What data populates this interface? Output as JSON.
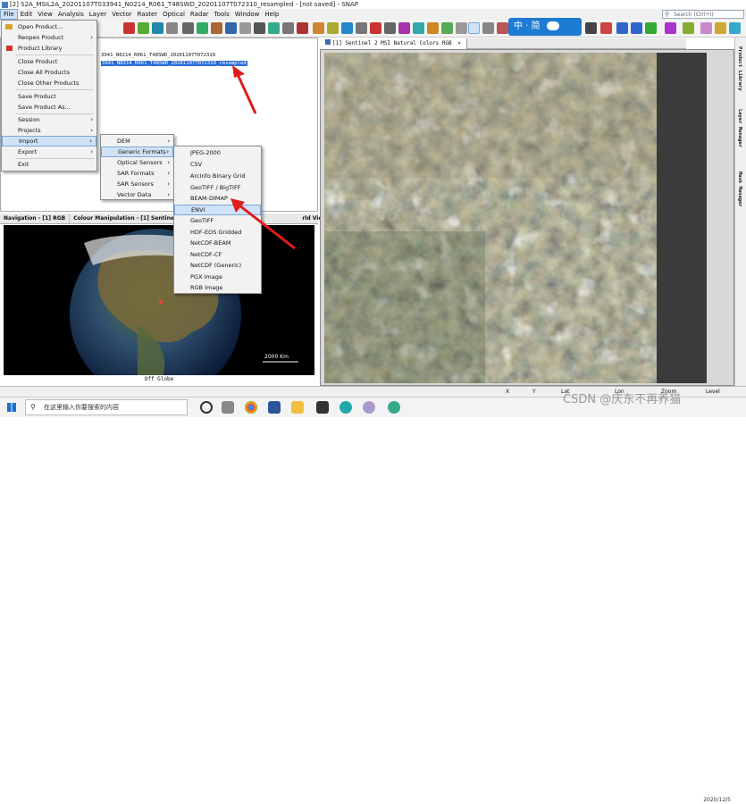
{
  "window": {
    "title": "[2] S2A_MSIL2A_20201107T033941_N0214_R061_T48SWD_20201107T072310_resampled - [not saved] - SNAP"
  },
  "menubar": [
    "File",
    "Edit",
    "View",
    "Analysis",
    "Layer",
    "Vector",
    "Raster",
    "Optical",
    "Radar",
    "Tools",
    "Window",
    "Help"
  ],
  "search_placeholder": "Search (Ctrl+I)",
  "ime": {
    "lang": "中",
    "mode": "简"
  },
  "file_menu": [
    {
      "label": "Open Product...",
      "arrow": ""
    },
    {
      "label": "Reopen Product",
      "arrow": "›"
    },
    {
      "label": "Product Library",
      "arrow": ""
    },
    {
      "label": "Close Product",
      "arrow": ""
    },
    {
      "label": "Close All Products",
      "arrow": ""
    },
    {
      "label": "Close Other Products",
      "arrow": ""
    },
    {
      "label": "Save Product",
      "arrow": ""
    },
    {
      "label": "Save Product As...",
      "arrow": ""
    },
    {
      "label": "Session",
      "arrow": "›"
    },
    {
      "label": "Projects",
      "arrow": "›"
    },
    {
      "label": "Import",
      "arrow": "›"
    },
    {
      "label": "Export",
      "arrow": "›"
    },
    {
      "label": "Exit",
      "arrow": ""
    }
  ],
  "import_menu": [
    {
      "label": "DEM",
      "arrow": "›"
    },
    {
      "label": "Generic Formats",
      "arrow": "›"
    },
    {
      "label": "Optical Sensors",
      "arrow": "›"
    },
    {
      "label": "SAR Formats",
      "arrow": "›"
    },
    {
      "label": "SAR Sensors",
      "arrow": "›"
    },
    {
      "label": "Vector Data",
      "arrow": "›"
    }
  ],
  "generic_menu": [
    "JPEG-2000",
    "CSV",
    "ArcInfo Binary Grid",
    "GeoTIFF / BigTIFF",
    "BEAM-DIMAP",
    "ENVI",
    "GeoTIFF",
    "HDF-EOS Gridded",
    "NetCDF-BEAM",
    "NetCDF-CF",
    "NetCDF (Generic)",
    "PGX Image",
    "RGB Image"
  ],
  "products": [
    "3941_N0214_R061_T48SWD_20201107T072310",
    "3941_N0214_R061_T48SWD_20201107T072310_resampled"
  ],
  "nav_tabs": [
    "Navigation - [1] RGB",
    "Colour Manipulation - [1] Sentinel 2 M—",
    "rld View"
  ],
  "globe": {
    "scale": "2000 Km",
    "caption": "Off Globe"
  },
  "image_tab": "[1] Sentinel 2 MSI Natural Colors RGB",
  "side_tabs": [
    "Product Library",
    "Layer Manager",
    "Mask Manager"
  ],
  "status": {
    "x": "X",
    "y": "Y",
    "lat": "Lat",
    "lon": "Lon",
    "zoom": "Zoom",
    "level": "Level"
  },
  "taskbar": {
    "search_placeholder": "在这里输入你要搜索的内容"
  },
  "clock": {
    "date": "2020/12/5"
  },
  "watermark": "CSDN @庆东不再养猫"
}
